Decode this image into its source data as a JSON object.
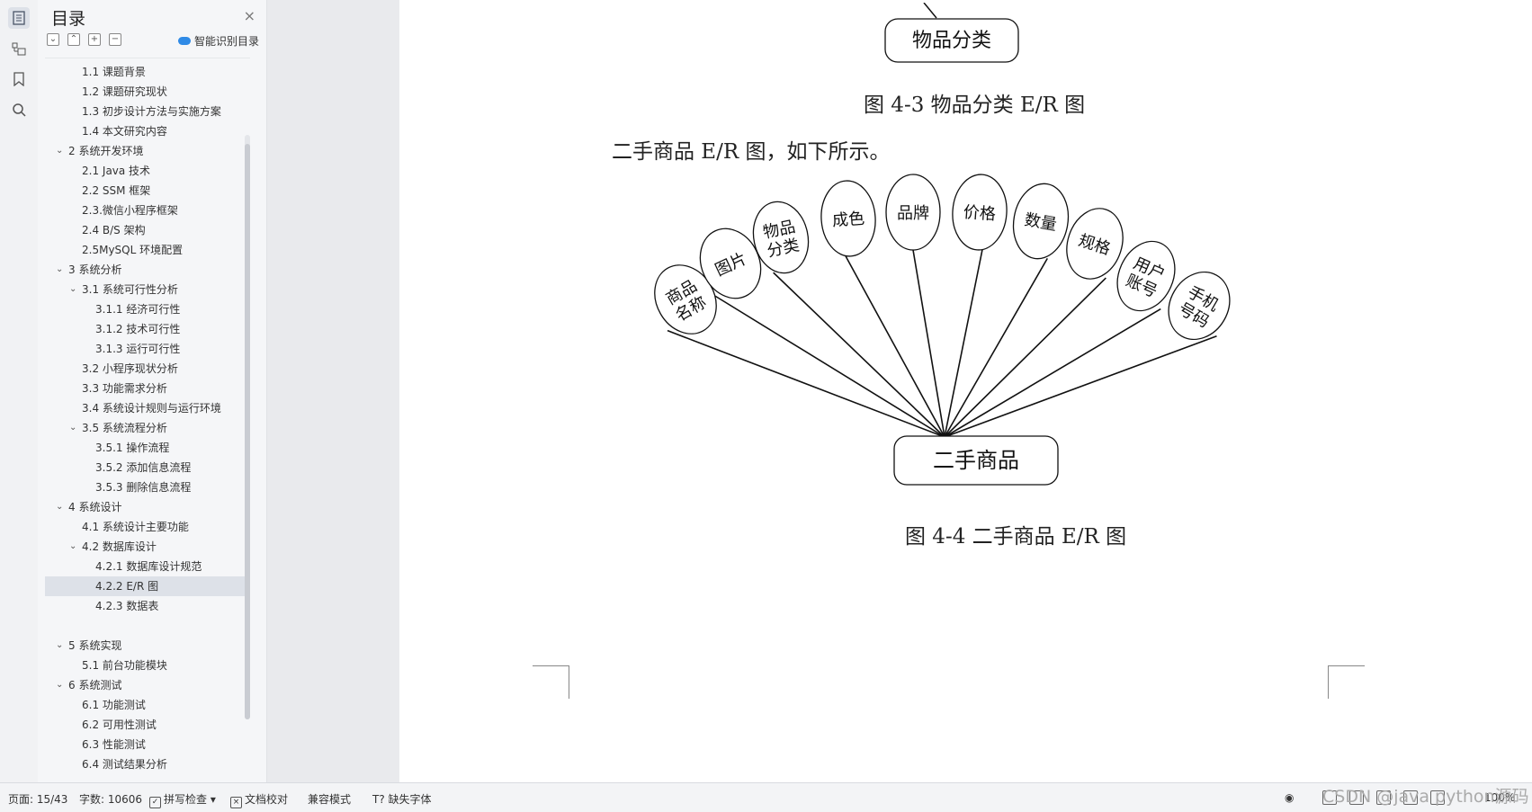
{
  "toc": {
    "title": "目录",
    "close": "×",
    "tools": [
      "⌄",
      "⌃",
      "+",
      "−"
    ],
    "smart_label": "智能识别目录",
    "items": [
      {
        "label": "1.1  课题背景",
        "level": 2,
        "chev": ""
      },
      {
        "label": "1.2  课题研究现状",
        "level": 2,
        "chev": ""
      },
      {
        "label": "1.3  初步设计方法与实施方案",
        "level": 2,
        "chev": ""
      },
      {
        "label": "1.4  本文研究内容",
        "level": 2,
        "chev": ""
      },
      {
        "label": "2  系统开发环境",
        "level": 1,
        "chev": "v"
      },
      {
        "label": "2.1 Java 技术",
        "level": 2,
        "chev": ""
      },
      {
        "label": "2.2 SSM 框架",
        "level": 2,
        "chev": ""
      },
      {
        "label": "2.3.微信小程序框架",
        "level": 2,
        "chev": ""
      },
      {
        "label": "2.4 B/S 架构",
        "level": 2,
        "chev": ""
      },
      {
        "label": "2.5MySQL 环境配置",
        "level": 2,
        "chev": ""
      },
      {
        "label": "3  系统分析",
        "level": 1,
        "chev": "v"
      },
      {
        "label": "3.1  系统可行性分析",
        "level": 2,
        "chev": "v"
      },
      {
        "label": "3.1.1  经济可行性",
        "level": 3,
        "chev": ""
      },
      {
        "label": "3.1.2  技术可行性",
        "level": 3,
        "chev": ""
      },
      {
        "label": "3.1.3  运行可行性",
        "level": 3,
        "chev": ""
      },
      {
        "label": "3.2  小程序现状分析",
        "level": 2,
        "chev": ""
      },
      {
        "label": "3.3  功能需求分析",
        "level": 2,
        "chev": ""
      },
      {
        "label": "3.4  系统设计规则与运行环境",
        "level": 2,
        "chev": ""
      },
      {
        "label": "3.5 系统流程分析",
        "level": 2,
        "chev": "v"
      },
      {
        "label": "3.5.1 操作流程",
        "level": 3,
        "chev": ""
      },
      {
        "label": "3.5.2 添加信息流程",
        "level": 3,
        "chev": ""
      },
      {
        "label": "3.5.3 删除信息流程",
        "level": 3,
        "chev": ""
      },
      {
        "label": "4  系统设计",
        "level": 1,
        "chev": "v"
      },
      {
        "label": "4.1  系统设计主要功能",
        "level": 2,
        "chev": ""
      },
      {
        "label": "4.2  数据库设计",
        "level": 2,
        "chev": "v"
      },
      {
        "label": "4.2.1  数据库设计规范",
        "level": 3,
        "chev": ""
      },
      {
        "label": "4.2.2    E/R 图",
        "level": 3,
        "chev": "",
        "selected": true
      },
      {
        "label": "4.2.3  数据表",
        "level": 3,
        "chev": ""
      },
      {
        "label": "",
        "level": 3,
        "chev": ""
      },
      {
        "label": "5  系统实现",
        "level": 1,
        "chev": "v"
      },
      {
        "label": "5.1 前台功能模块",
        "level": 2,
        "chev": ""
      },
      {
        "label": "6  系统测试",
        "level": 1,
        "chev": "v"
      },
      {
        "label": "6.1  功能测试",
        "level": 2,
        "chev": ""
      },
      {
        "label": "6.2  可用性测试",
        "level": 2,
        "chev": ""
      },
      {
        "label": "6.3  性能测试",
        "level": 2,
        "chev": ""
      },
      {
        "label": "6.4  测试结果分析",
        "level": 2,
        "chev": ""
      }
    ]
  },
  "document": {
    "top_entity": "物品分类",
    "caption_43": "图 4-3 物品分类 E/R 图",
    "paragraph": "二手商品 E/R 图，如下所示。",
    "center_entity": "二手商品",
    "caption_44": "图 4-4 二手商品 E/R 图",
    "attributes": [
      {
        "l1": "商品",
        "l2": "名称"
      },
      {
        "l1": "图片",
        "l2": ""
      },
      {
        "l1": "物品",
        "l2": "分类"
      },
      {
        "l1": "成色",
        "l2": ""
      },
      {
        "l1": "品牌",
        "l2": ""
      },
      {
        "l1": "价格",
        "l2": ""
      },
      {
        "l1": "数量",
        "l2": ""
      },
      {
        "l1": "规格",
        "l2": ""
      },
      {
        "l1": "用户",
        "l2": "账号"
      },
      {
        "l1": "手机",
        "l2": "号码"
      }
    ]
  },
  "statusbar": {
    "page": "页面: 15/43",
    "words": "字数: 10606",
    "spell": "拼写检查",
    "proof": "文档校对",
    "compat": "兼容模式",
    "missing_font": "缺失字体",
    "zoom": "100%"
  },
  "watermark": "CSDN @java python源码"
}
